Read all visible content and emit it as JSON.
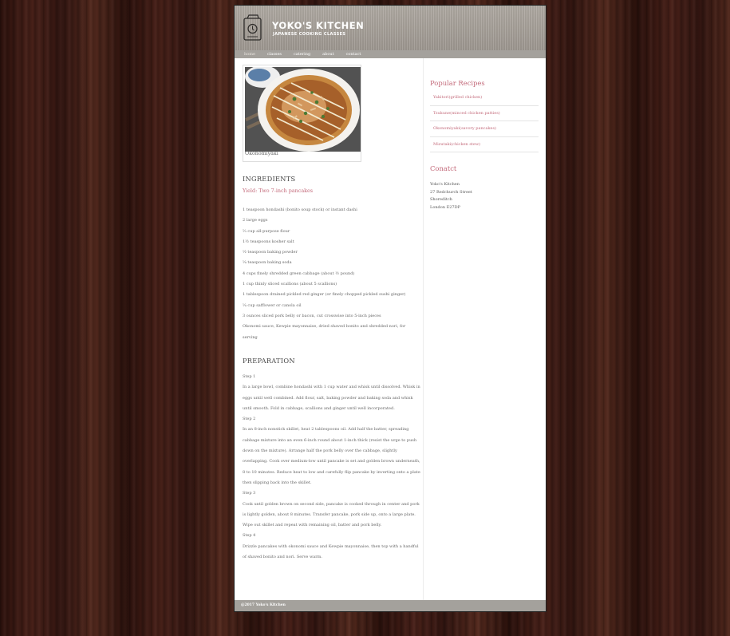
{
  "site": {
    "title": "YOKO'S KITCHEN",
    "subtitle": "JAPANESE COOKING CLASSES"
  },
  "nav": [
    "home",
    "classes",
    "catering",
    "about",
    "contact"
  ],
  "figure": {
    "caption": "Okonomiyaki"
  },
  "ingredients": {
    "heading": "INGREDIENTS",
    "yield": "Yield: Two 7-inch pancakes",
    "items": [
      "1 teaspoon hondashi (bonito soup stock) or instant dashi",
      "2 large eggs",
      "⅔ cup all-purpose flour",
      "1½ teaspoons kosher salt",
      "½ teaspoon baking powder",
      "¼ teaspoon baking soda",
      "4 cups finely shredded green cabbage (about ½ pound)",
      "1 cup thinly sliced scallions (about 5 scallions)",
      "1 tablespoon drained pickled red ginger (or finely chopped pickled sushi ginger)",
      "¼ cup safflower or canola oil",
      "3 ounces sliced pork belly or bacon, cut crosswise into 5-inch pieces",
      "Okonomi sauce, Kewpie mayonnaise, dried shaved bonito and shredded nori, for serving"
    ]
  },
  "preparation": {
    "heading": "PREPARATION",
    "steps": [
      {
        "label": "Step 1",
        "text": "In a large bowl, combine hondashi with 1 cup water and whisk until dissolved. Whisk in eggs until well combined. Add flour, salt, baking powder and baking soda and whisk until smooth. Fold in cabbage, scallions and ginger until well incorporated."
      },
      {
        "label": "Step 2",
        "text": "In an 8-inch nonstick skillet, heat 2 tablespoons oil. Add half the batter, spreading cabbage mixture into an even 6-inch round about 1-inch thick (resist the urge to push down on the mixture). Arrange half the pork belly over the cabbage, slightly overlapping. Cook over medium-low until pancake is set and golden brown underneath, 8 to 10 minutes. Reduce heat to low and carefully flip pancake by inverting onto a plate then slipping back into the skillet."
      },
      {
        "label": "Step 3",
        "text": "Cook until golden brown on second side, pancake is cooked through in center and pork is lightly golden, about 8 minutes. Transfer pancake, pork side up, onto a large plate. Wipe out skillet and repeat with remaining oil, batter and pork belly."
      },
      {
        "label": "Step 4",
        "text": "Drizzle pancakes with okonomi sauce and Kewpie mayonnaise, then top with a handful of shaved bonito and nori. Serve warm."
      }
    ]
  },
  "sidebar": {
    "popular_heading": "Popular Recipes",
    "recipes": [
      "Yakitori(grilled chicken)",
      "Tsukune(minced chicken patties)",
      "Okonomiyaki(savory pancakes)",
      "Mizutaki(chicken stew)"
    ],
    "contact_heading": "Conatct",
    "address": [
      "Yoko's Kitchen",
      "27 Redchurch Street",
      "Shoreditch",
      "London E27DP"
    ]
  },
  "footer": "@2017 Yoko's Kitchen",
  "colors": {
    "accent": "#c36a7a",
    "bar": "#a4a19c",
    "header": "#a7a19a"
  }
}
